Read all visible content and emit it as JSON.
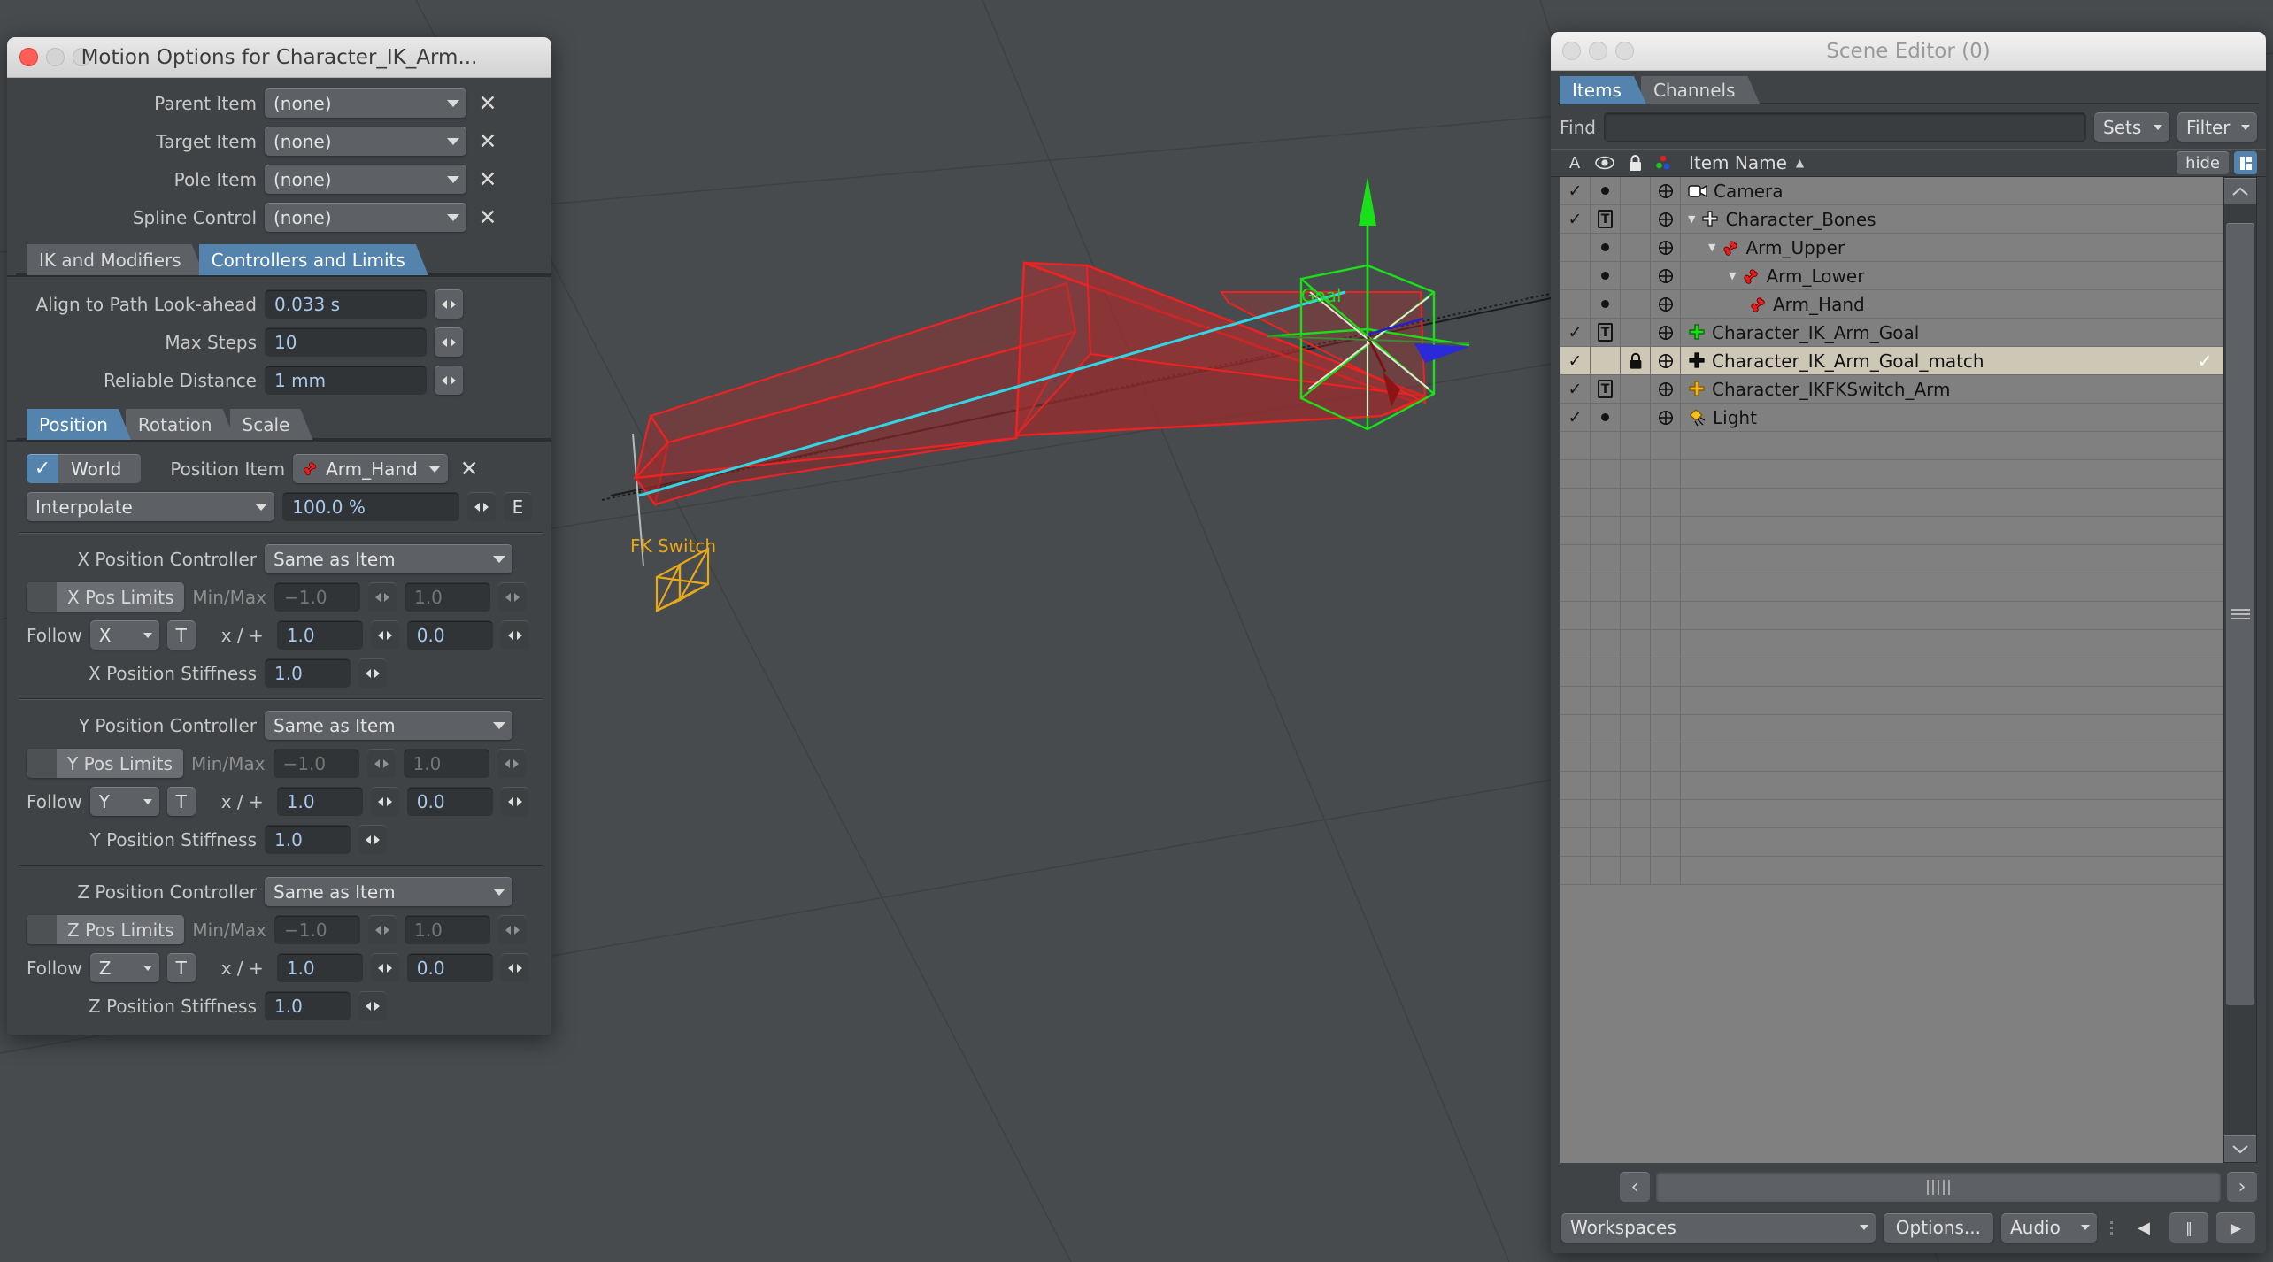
{
  "motion_window": {
    "title": "Motion Options for Character_IK_Arm...",
    "top_fields": [
      {
        "label": "Parent Item",
        "value": "(none)",
        "clear": "✕"
      },
      {
        "label": "Target Item",
        "value": "(none)",
        "clear": "✕"
      },
      {
        "label": "Pole Item",
        "value": "(none)",
        "clear": "✕"
      },
      {
        "label": "Spline Control",
        "value": "(none)",
        "clear": "✕"
      }
    ],
    "main_tabs": [
      {
        "label": "IK and Modifiers",
        "active": false
      },
      {
        "label": "Controllers and Limits",
        "active": true
      }
    ],
    "controller_fields": [
      {
        "label": "Align to Path Look-ahead",
        "value": "0.033 s"
      },
      {
        "label": "Max Steps",
        "value": "10"
      },
      {
        "label": "Reliable Distance",
        "value": "1 mm"
      }
    ],
    "transform_tabs": [
      {
        "label": "Position",
        "active": true
      },
      {
        "label": "Rotation",
        "active": false
      },
      {
        "label": "Scale",
        "active": false
      }
    ],
    "world_row": {
      "check": "✓",
      "world_label": "World",
      "position_item_label": "Position Item",
      "position_item_value": "Arm_Hand",
      "clear": "✕"
    },
    "interp_row": {
      "method": "Interpolate",
      "percent": "100.0 %",
      "envelope_button": "E"
    },
    "axes": [
      {
        "controller_label": "X Position Controller",
        "controller_value": "Same as Item",
        "limits_label": "X Pos Limits",
        "minmax_label": "Min/Max",
        "min": "−1.0",
        "max": "1.0",
        "follow_label": "Follow",
        "follow_axis": "X",
        "time_button": "T",
        "xplus_label": "x / +",
        "multiplier": "1.0",
        "offset": "0.0",
        "stiffness_label": "X Position Stiffness",
        "stiffness": "1.0"
      },
      {
        "controller_label": "Y Position Controller",
        "controller_value": "Same as Item",
        "limits_label": "Y Pos Limits",
        "minmax_label": "Min/Max",
        "min": "−1.0",
        "max": "1.0",
        "follow_label": "Follow",
        "follow_axis": "Y",
        "time_button": "T",
        "xplus_label": "x / +",
        "multiplier": "1.0",
        "offset": "0.0",
        "stiffness_label": "Y Position Stiffness",
        "stiffness": "1.0"
      },
      {
        "controller_label": "Z Position Controller",
        "controller_value": "Same as Item",
        "limits_label": "Z Pos Limits",
        "minmax_label": "Min/Max",
        "min": "−1.0",
        "max": "1.0",
        "follow_label": "Follow",
        "follow_axis": "Z",
        "time_button": "T",
        "xplus_label": "x / +",
        "multiplier": "1.0",
        "offset": "0.0",
        "stiffness_label": "Z Position Stiffness",
        "stiffness": "1.0"
      }
    ]
  },
  "scene_editor": {
    "title": "Scene Editor (0)",
    "tabs": [
      {
        "label": "Items",
        "active": true
      },
      {
        "label": "Channels",
        "active": false
      }
    ],
    "find": {
      "label": "Find",
      "value": "",
      "placeholder": ""
    },
    "sets_button": "Sets",
    "filter_button": "Filter",
    "columns": {
      "active": "A",
      "visibility": "eye-icon",
      "lock": "lock-icon",
      "color": "rgb-dots-icon",
      "name": "Item  Name",
      "sort": "▲",
      "hide_button": "hide",
      "column-config": "column-config-icon"
    },
    "items": [
      {
        "name": "Camera",
        "icon": "camera",
        "active": "✓",
        "vis": "dot",
        "lock": "",
        "indent": 0,
        "expander": "",
        "selected": false
      },
      {
        "name": "Character_Bones",
        "icon": "null-white",
        "active": "✓",
        "vis": "T",
        "lock": "",
        "indent": 0,
        "expander": "▼",
        "selected": false
      },
      {
        "name": "Arm_Upper",
        "icon": "bone",
        "active": "",
        "vis": "dot",
        "lock": "",
        "indent": 1,
        "expander": "▼",
        "selected": false
      },
      {
        "name": "Arm_Lower",
        "icon": "bone",
        "active": "",
        "vis": "dot",
        "lock": "",
        "indent": 2,
        "expander": "▼",
        "selected": false
      },
      {
        "name": "Arm_Hand",
        "icon": "bone",
        "active": "",
        "vis": "dot",
        "lock": "",
        "indent": 3,
        "expander": "",
        "selected": false
      },
      {
        "name": "Character_IK_Arm_Goal",
        "icon": "null-green",
        "active": "✓",
        "vis": "T",
        "lock": "",
        "indent": 0,
        "expander": "",
        "selected": false
      },
      {
        "name": "Character_IK_Arm_Goal_match",
        "icon": "null-black",
        "active": "✓",
        "vis": "",
        "lock": "lock-icon",
        "indent": 0,
        "expander": "",
        "selected": true
      },
      {
        "name": "Character_IKFKSwitch_Arm",
        "icon": "null-gold",
        "active": "✓",
        "vis": "T",
        "lock": "",
        "indent": 0,
        "expander": "",
        "selected": false
      },
      {
        "name": "Light",
        "icon": "light",
        "active": "✓",
        "vis": "dot",
        "lock": "",
        "indent": 0,
        "expander": "",
        "selected": false
      }
    ],
    "selection_check": "✓",
    "blank_row_count": 16,
    "scroll": {
      "up": "∧",
      "down": "∨",
      "left": "‹",
      "right": "›"
    },
    "bottom_bar": {
      "workspaces": "Workspaces",
      "options": "Options...",
      "audio": "Audio",
      "prev": "◀",
      "pause": "‖",
      "play": "▶"
    }
  },
  "viewport": {
    "goal_label": "Goal",
    "fk_switch_label": "FK Switch",
    "colors": {
      "background": "#474b4e",
      "bone": "#ee2222",
      "goal": "#19e019",
      "ik_line": "#2fd6e8",
      "fk_switch": "#e8a81c",
      "axis_x": "#b00000",
      "axis_y": "#19e019",
      "axis_z": "#2222cc"
    }
  }
}
